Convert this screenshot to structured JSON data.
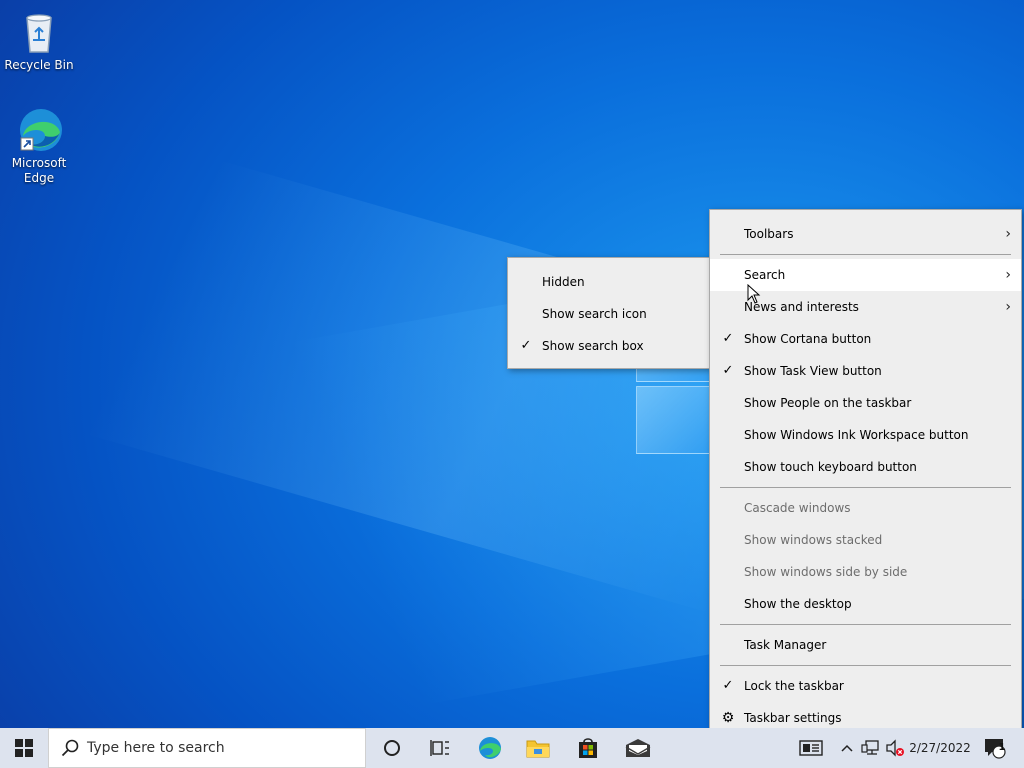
{
  "desktop": {
    "icons": [
      {
        "label": "Recycle Bin",
        "icon": "recycle-bin-icon"
      },
      {
        "label": "Microsoft Edge",
        "icon": "edge-icon"
      }
    ]
  },
  "context_menu": {
    "items": [
      {
        "label": "Toolbars",
        "submenu": true
      },
      {
        "label": "Search",
        "submenu": true,
        "highlighted": true
      },
      {
        "label": "News and interests",
        "submenu": true
      },
      {
        "label": "Show Cortana button",
        "checked": true
      },
      {
        "label": "Show Task View button",
        "checked": true
      },
      {
        "label": "Show People on the taskbar"
      },
      {
        "label": "Show Windows Ink Workspace button"
      },
      {
        "label": "Show touch keyboard button"
      },
      {
        "label": "Cascade windows",
        "disabled": true
      },
      {
        "label": "Show windows stacked",
        "disabled": true
      },
      {
        "label": "Show windows side by side",
        "disabled": true
      },
      {
        "label": "Show the desktop"
      },
      {
        "label": "Task Manager"
      },
      {
        "label": "Lock the taskbar",
        "checked": true
      },
      {
        "label": "Taskbar settings",
        "icon": "gear-icon"
      }
    ]
  },
  "search_submenu": {
    "items": [
      {
        "label": "Hidden"
      },
      {
        "label": "Show search icon"
      },
      {
        "label": "Show search box",
        "checked": true
      }
    ]
  },
  "taskbar": {
    "search_placeholder": "Type here to search",
    "clock": "2/27/2022",
    "notification_count": "1",
    "accent": "#0078d7"
  }
}
